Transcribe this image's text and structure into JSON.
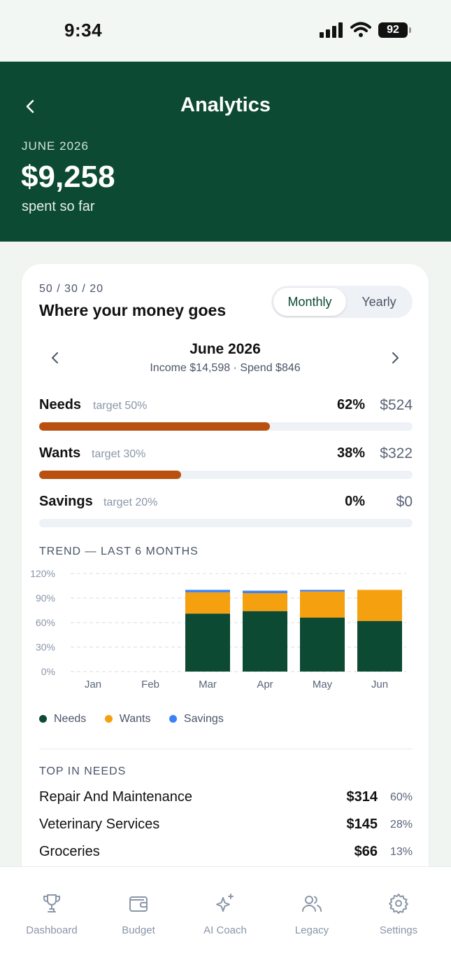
{
  "status": {
    "time": "9:34",
    "battery": "92"
  },
  "header": {
    "title": "Analytics",
    "month": "JUNE 2026",
    "amount": "$9,258",
    "subtitle": "spent so far"
  },
  "card": {
    "ratio": "50 / 30 / 20",
    "title": "Where your money goes",
    "toggle": {
      "active": "Monthly",
      "inactive": "Yearly"
    },
    "period": "June 2026",
    "period_sub": "Income $14,598 · Spend $846",
    "categories": [
      {
        "name": "Needs",
        "target": "target 50%",
        "percent": "62%",
        "amount": "$524",
        "fill": 0.62
      },
      {
        "name": "Wants",
        "target": "target 30%",
        "percent": "38%",
        "amount": "$322",
        "fill": 0.38
      },
      {
        "name": "Savings",
        "target": "target 20%",
        "percent": "0%",
        "amount": "$0",
        "fill": 0
      }
    ],
    "trend_title": "TREND — LAST 6 MONTHS",
    "legend": [
      "Needs",
      "Wants",
      "Savings"
    ],
    "top_title": "TOP IN NEEDS",
    "top_items": [
      {
        "name": "Repair And Maintenance",
        "amount": "$314",
        "percent": "60%"
      },
      {
        "name": "Veterinary Services",
        "amount": "$145",
        "percent": "28%"
      },
      {
        "name": "Groceries",
        "amount": "$66",
        "percent": "13%"
      }
    ]
  },
  "chart_data": {
    "type": "bar",
    "stacked": true,
    "categories": [
      "Jan",
      "Feb",
      "Mar",
      "Apr",
      "May",
      "Jun"
    ],
    "series": [
      {
        "name": "Needs",
        "color": "#0c4a33",
        "values": [
          0,
          0,
          71,
          74,
          66,
          62
        ]
      },
      {
        "name": "Wants",
        "color": "#f5a00f",
        "values": [
          0,
          0,
          26,
          22,
          32,
          38
        ]
      },
      {
        "name": "Savings",
        "color": "#3b82f6",
        "values": [
          0,
          0,
          3,
          3,
          2,
          0
        ]
      }
    ],
    "ylim": [
      0,
      120
    ],
    "yticks": [
      "0%",
      "30%",
      "60%",
      "90%",
      "120%"
    ],
    "grid": true
  },
  "tabs": [
    "Dashboard",
    "Budget",
    "AI Coach",
    "Legacy",
    "Settings"
  ],
  "colors": {
    "brand": "#0c4a33",
    "bar": "#b9500f",
    "needs": "#0c4a33",
    "wants": "#f5a00f",
    "savings": "#3b82f6"
  }
}
